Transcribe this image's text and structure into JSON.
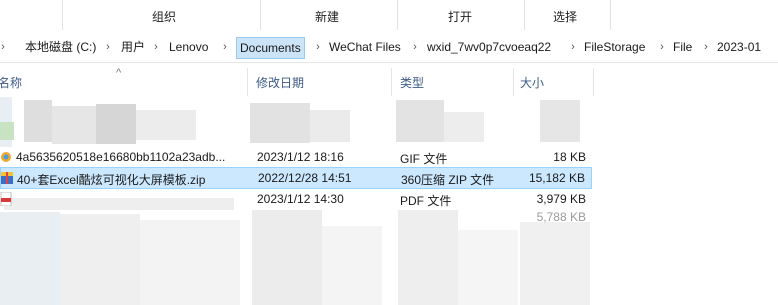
{
  "ribbon": {
    "groups": [
      "组织",
      "新建",
      "打开",
      "选择"
    ]
  },
  "address": {
    "crumbs": [
      "本地磁盘 (C:)",
      "用户",
      "Lenovo",
      "Documents",
      "WeChat Files",
      "wxid_7wv0p7cvoeaq22",
      "FileStorage",
      "File",
      "2023-01"
    ]
  },
  "columns": {
    "name": "名称",
    "date": "修改日期",
    "type": "类型",
    "size": "大小"
  },
  "files": [
    {
      "name": "4a5635620518e16680bb1102a23adb...",
      "date": "2023/1/12 18:16",
      "type": "GIF 文件",
      "size": "18 KB",
      "icon": "gif-file-icon",
      "selected": false
    },
    {
      "name": "40+套Excel酷炫可视化大屏模板.zip",
      "date": "2022/12/28 14:51",
      "type": "360压缩 ZIP 文件",
      "size": "15,182 KB",
      "icon": "zip-archive-icon",
      "selected": true
    },
    {
      "name": "",
      "date": "2023/1/12 14:30",
      "type": "PDF 文件",
      "size": "3,979 KB",
      "icon": "pdf-file-icon",
      "selected": false
    },
    {
      "name": "",
      "date": "",
      "type": "",
      "size": "5,788 KB",
      "icon": "",
      "selected": false
    }
  ],
  "colors": {
    "selection_bg": "#cce8ff",
    "selection_border": "#99d1ff",
    "header_text": "#3c5a86",
    "breadcrumb_highlight": "#cce4f7"
  }
}
